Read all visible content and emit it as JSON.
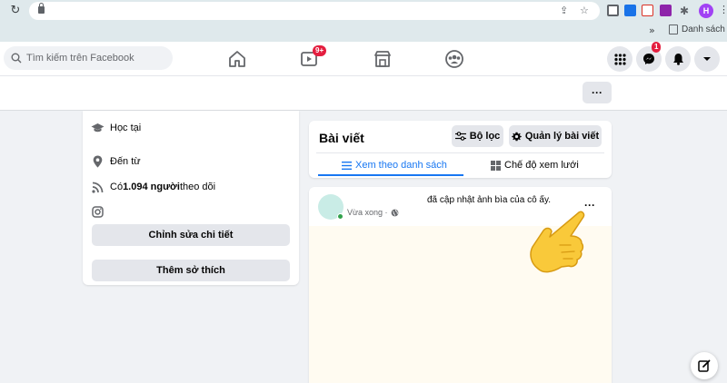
{
  "browser": {
    "bookmarks_chevron": "»",
    "bookmark_label": "Danh sách đọ",
    "profile_initial": "H"
  },
  "header": {
    "search_placeholder": "Tìm kiếm trên Facebook",
    "watch_badge": "9+",
    "messenger_badge": "1"
  },
  "intro": {
    "education": "Học tại",
    "from_prefix": "Đến từ",
    "followers_prefix": "Có ",
    "followers_count": "1.094 người",
    "followers_suffix": " theo dõi",
    "edit_details": "Chỉnh sửa chi tiết",
    "add_hobbies": "Thêm sở thích"
  },
  "posts": {
    "title": "Bài viết",
    "filter": "Bộ lọc",
    "manage": "Quản lý bài viết",
    "tab_list": "Xem theo danh sách",
    "tab_grid": "Chế độ xem lưới"
  },
  "post": {
    "action": "đã cập nhật ảnh bìa của cô ấy.",
    "time": "Vừa xong ·"
  },
  "colors": {
    "accent": "#1877f2",
    "badge": "#e41e3f",
    "chrome": "#dfe9ec"
  }
}
